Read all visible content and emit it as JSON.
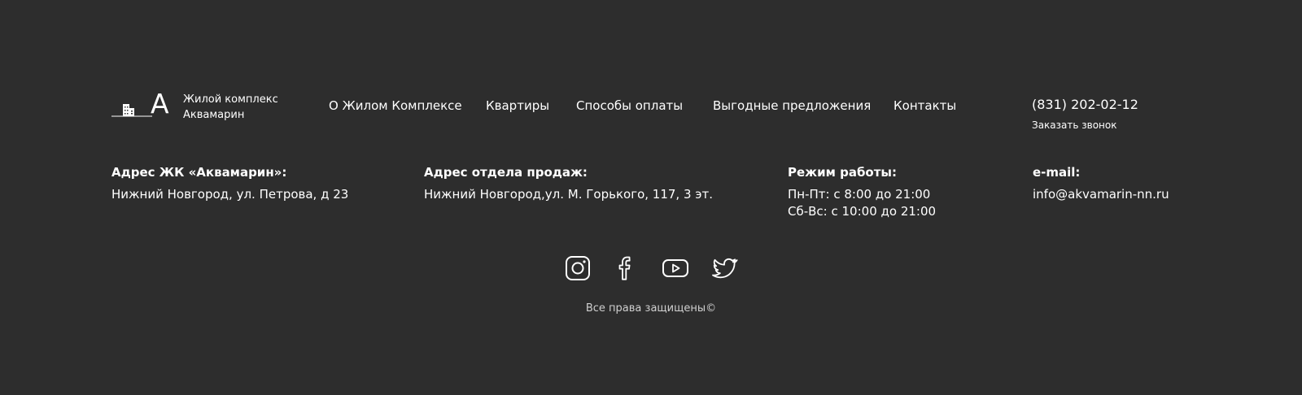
{
  "logo": {
    "letter": "A",
    "line1": "Жилой комплекс",
    "line2": "Аквамарин"
  },
  "nav": {
    "items": [
      {
        "label": "О Жилом Комплексе"
      },
      {
        "label": "Квартиры"
      },
      {
        "label": "Способы оплаты"
      },
      {
        "label": "Выгодные предложения"
      },
      {
        "label": "Контакты"
      }
    ]
  },
  "contact": {
    "phone": "(831) 202-02-12",
    "callback_label": "Заказать звонок"
  },
  "info": {
    "complex_address": {
      "title": "Адрес ЖК «Аквамарин»:",
      "value": "Нижний Новгород, ул. Петрова, д 23"
    },
    "sales_address": {
      "title": "Адрес отдела продаж:",
      "value": "Нижний Новгород,ул. М. Горького, 117, 3 эт."
    },
    "hours": {
      "title": "Режим работы:",
      "weekdays": "Пн-Пт: с 8:00 до 21:00",
      "weekend": "Сб-Вс: с 10:00 до 21:00"
    },
    "email": {
      "title": "e-mail:",
      "value": "info@akvamarin-nn.ru"
    }
  },
  "social": {
    "icons": [
      "instagram-icon",
      "facebook-icon",
      "youtube-icon",
      "twitter-icon"
    ]
  },
  "footer": {
    "copyright": "Все права защищены©"
  },
  "colors": {
    "background": "#2d2d2d",
    "text": "#ffffff",
    "muted": "#cfcfcf"
  }
}
